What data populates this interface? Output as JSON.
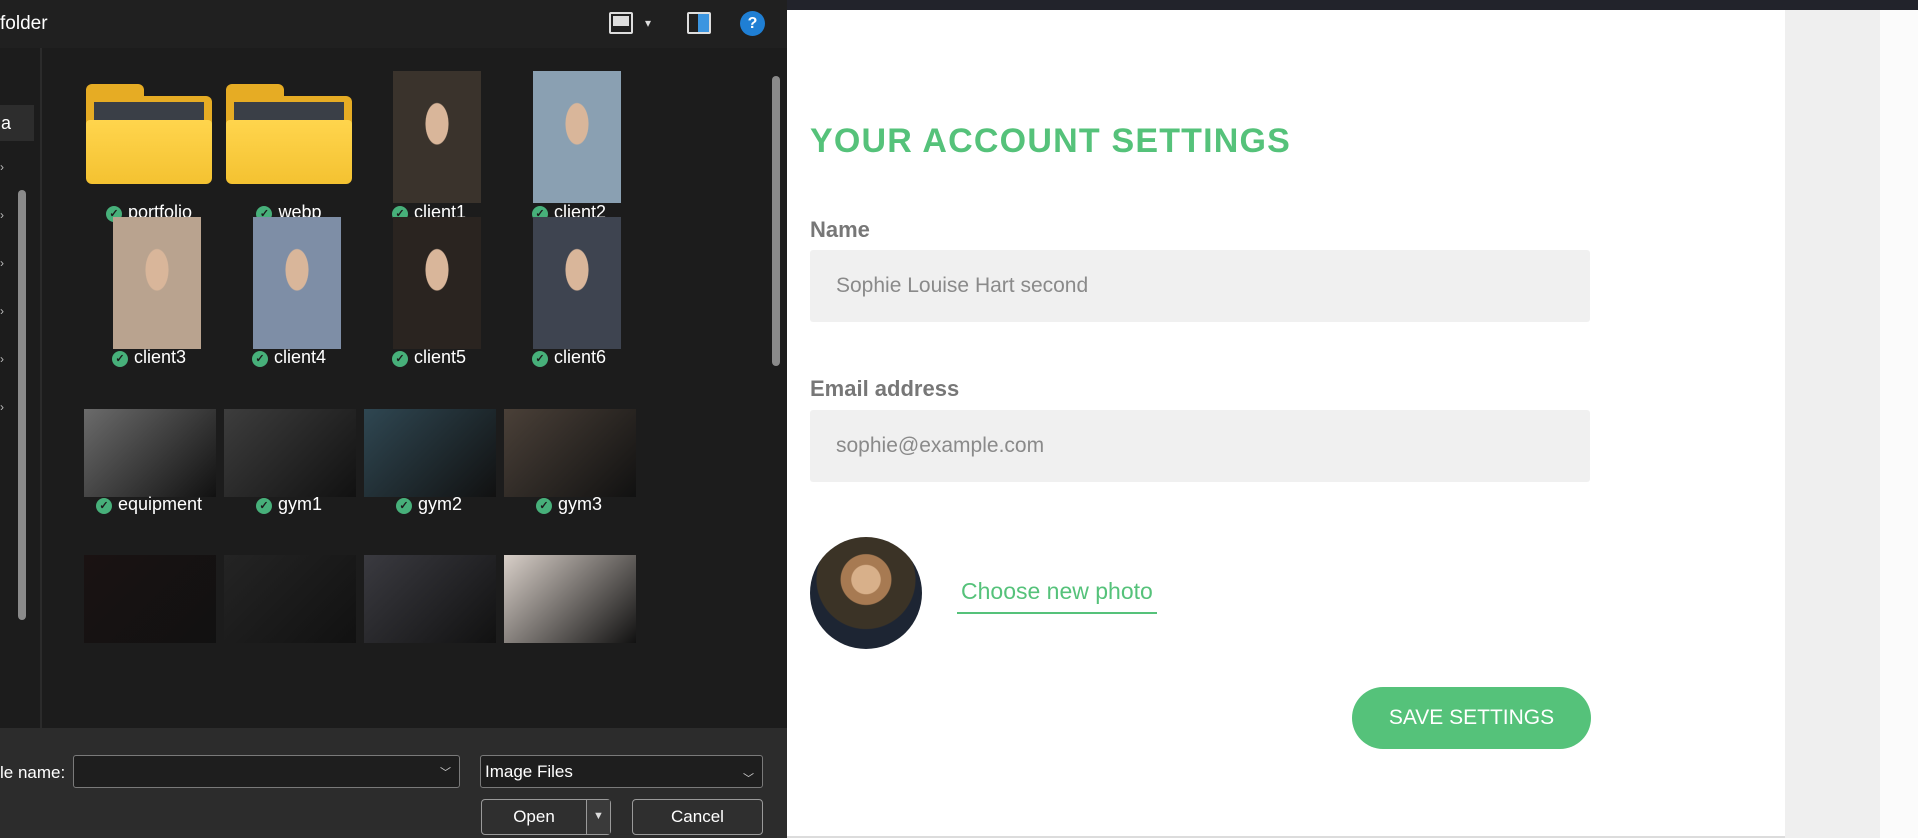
{
  "dialog": {
    "title": "folder",
    "nav_item": "a",
    "items": [
      {
        "label": "portfolio",
        "kind": "folder"
      },
      {
        "label": "webp",
        "kind": "folder"
      },
      {
        "label": "client1",
        "kind": "photo",
        "tint": "#3a332c"
      },
      {
        "label": "client2",
        "kind": "photo",
        "tint": "#8aa0b2"
      },
      {
        "label": "client3",
        "kind": "photo",
        "tint": "#b9a38f"
      },
      {
        "label": "client4",
        "kind": "photo",
        "tint": "#7e8ea6"
      },
      {
        "label": "client5",
        "kind": "photo",
        "tint": "#2a2420"
      },
      {
        "label": "client6",
        "kind": "photo",
        "tint": "#3e4450"
      },
      {
        "label": "equipment",
        "kind": "wide",
        "tint": "#6b6b6b"
      },
      {
        "label": "gym1",
        "kind": "wide",
        "tint": "#3d3d3d"
      },
      {
        "label": "gym2",
        "kind": "wide",
        "tint": "#2f4752"
      },
      {
        "label": "gym3",
        "kind": "wide",
        "tint": "#4a4038"
      },
      {
        "label": "",
        "kind": "wide",
        "tint": "#1a1212"
      },
      {
        "label": "",
        "kind": "wide",
        "tint": "#242424"
      },
      {
        "label": "",
        "kind": "wide",
        "tint": "#3a3a40"
      },
      {
        "label": "",
        "kind": "wide",
        "tint": "#d8cfc8"
      }
    ],
    "file_name_label": "le name:",
    "file_name_value": "",
    "filter_label": "Image Files",
    "open_label": "Open",
    "cancel_label": "Cancel",
    "colors": {
      "checkmark": "#47b07a",
      "folder": "#f4c231"
    }
  },
  "settings": {
    "title": "YOUR ACCOUNT SETTINGS",
    "name_label": "Name",
    "name_value": "Sophie Louise Hart second",
    "email_label": "Email address",
    "email_value": "sophie@example.com",
    "choose_photo": "Choose new photo",
    "save_button": "SAVE SETTINGS",
    "colors": {
      "accent": "#55c27a",
      "field_bg": "#f0f0f0"
    }
  }
}
